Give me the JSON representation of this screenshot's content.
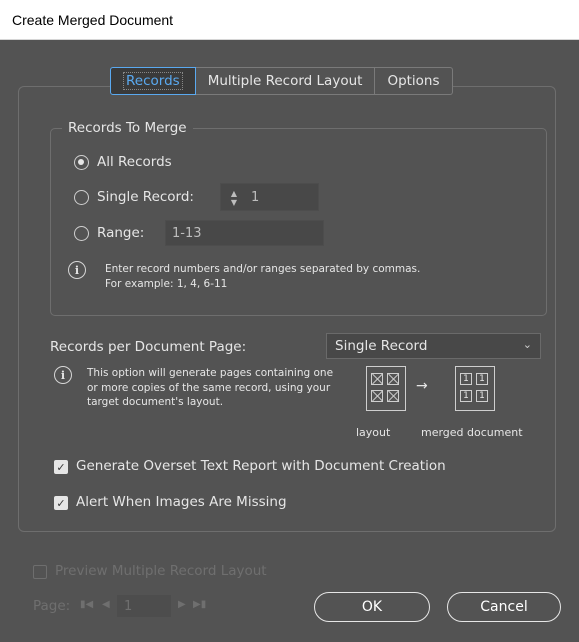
{
  "window": {
    "title": "Create Merged Document"
  },
  "tabs": [
    {
      "label": "Records",
      "active": true
    },
    {
      "label": "Multiple Record Layout",
      "active": false
    },
    {
      "label": "Options",
      "active": false
    }
  ],
  "records_group": {
    "title": "Records To Merge",
    "all_records_label": "All Records",
    "single_record_label": "Single Record:",
    "single_record_value": "1",
    "range_label": "Range:",
    "range_value": "1-13",
    "selected": "all",
    "info_text": "Enter record numbers and/or ranges separated by commas. For example: 1, 4, 6-11"
  },
  "records_per_page": {
    "label": "Records per Document Page:",
    "selected": "Single Record",
    "info_text": "This option will generate pages containing one or more copies of the same record, using your target document's layout.",
    "diagram": {
      "layout_caption": "layout",
      "arrow": "→",
      "cell_number": "1",
      "merged_caption": "merged document"
    }
  },
  "options": {
    "overset_report_label": "Generate Overset Text Report with Document Creation",
    "overset_report_checked": true,
    "alert_images_label": "Alert When Images Are Missing",
    "alert_images_checked": true
  },
  "preview": {
    "label": "Preview Multiple Record Layout",
    "checked": false,
    "page_label": "Page:",
    "page_value": "1"
  },
  "buttons": {
    "ok": "OK",
    "cancel": "Cancel"
  },
  "colors": {
    "background": "#535353",
    "accent": "#5aa9f0",
    "text": "#e6e6e6",
    "disabled": "#6f6f6f"
  }
}
